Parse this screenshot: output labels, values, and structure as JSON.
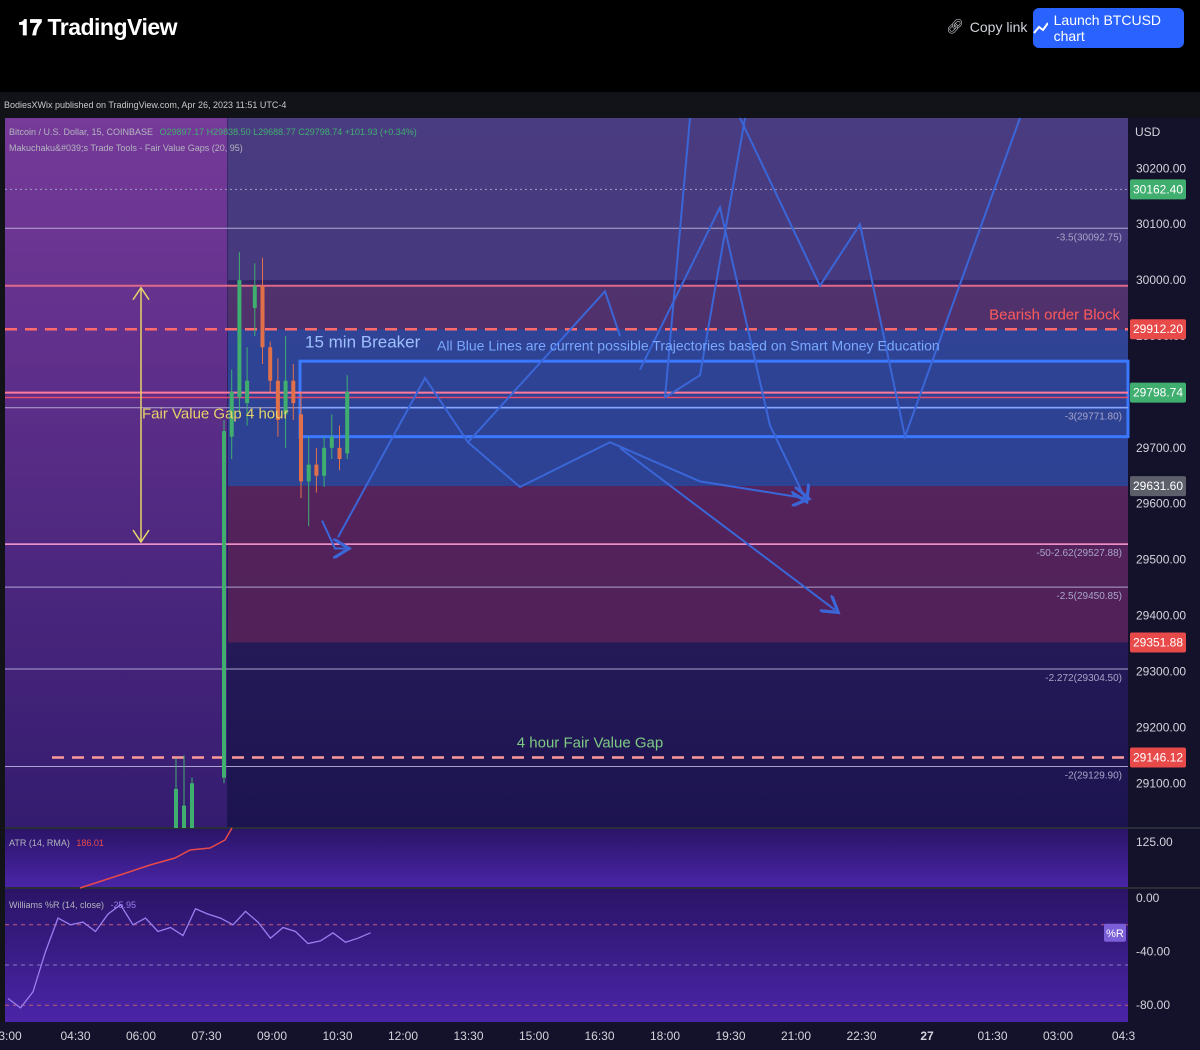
{
  "header": {
    "logo_text": "TradingView",
    "copy_link": "Copy link",
    "launch_button": "Launch BTCUSD chart"
  },
  "attribution": "BodiesXWix published on TradingView.com, Apr 26, 2023 11:51 UTC-4",
  "legend": {
    "symbol": "Bitcoin / U.S. Dollar, 15, COINBASE",
    "ohlc": "O29897.17  H29838.50  L29688.77  C29798.74  +101.93 (+0.34%)",
    "indicator": "Makuchaku&#039;s Trade Tools - Fair Value Gaps (20, 95)"
  },
  "atr": {
    "label": "ATR (14, RMA)",
    "value": "186.01",
    "axis_label": "125.00"
  },
  "williams": {
    "label": "Williams %R (14, close)",
    "value": "-25.95",
    "badge": "%R",
    "ticks": [
      "0.00",
      "-40.00",
      "-80.00"
    ]
  },
  "colors": {
    "blue_line": "#3a66d8",
    "bear_block": "#e84a4a",
    "fvg_yellow": "#e6d36a",
    "fvg_green": "#7fca84",
    "candle_up": "#3fae6f",
    "candle_down": "#e0704a"
  },
  "chart_data": {
    "type": "line",
    "symbol": "BTCUSD",
    "timeframe": "15",
    "currency": "USD",
    "ylim": [
      29020,
      30290
    ],
    "y_ticks": [
      30200,
      30100,
      30000,
      29900,
      29800,
      29700,
      29600,
      29500,
      29400,
      29300,
      29200,
      29100
    ],
    "x_ticks": [
      "3:00",
      "04:30",
      "06:00",
      "07:30",
      "09:00",
      "10:30",
      "12:00",
      "13:30",
      "15:00",
      "16:30",
      "18:00",
      "19:30",
      "21:00",
      "22:30",
      "27",
      "01:30",
      "03:00",
      "04:3"
    ],
    "price_labels": [
      {
        "value": 30162.4,
        "text": "30162.40",
        "color": "#3fae6f"
      },
      {
        "value": 29912.2,
        "text": "29912.20",
        "color": "#e84a4a"
      },
      {
        "value": 29798.74,
        "text": "29798.74",
        "color": "#3fae6f"
      },
      {
        "value": 29631.6,
        "text": "29631.60",
        "color": "#5d606b"
      },
      {
        "value": 29351.88,
        "text": "29351.88",
        "color": "#e84a4a"
      },
      {
        "value": 29146.12,
        "text": "29146.12",
        "color": "#e84a4a"
      }
    ],
    "fib_levels": [
      {
        "value": 30092.75,
        "text": "-3.5(30092.75)"
      },
      {
        "value": 29771.8,
        "text": "-3(29771.80)"
      },
      {
        "value": 29527.88,
        "text": "-50-2.62(29527.88)"
      },
      {
        "value": 29450.85,
        "text": "-2.5(29450.85)"
      },
      {
        "value": 29304.5,
        "text": "-2.272(29304.50)"
      },
      {
        "value": 29129.9,
        "text": "-2(29129.90)"
      }
    ],
    "annotations": {
      "bearish_block": "Bearish order Block",
      "breaker": "15 min Breaker",
      "trajectories": "All Blue Lines are current possible Trajectories based on Smart Money Education",
      "fvg_4h_left": "Fair Value Gap 4 hour",
      "fvg_4h_bottom": "4 hour Fair Value Gap"
    },
    "candles": [
      {
        "o": 29020,
        "h": 29145,
        "l": 29020,
        "c": 29090
      },
      {
        "o": 29020,
        "h": 29150,
        "l": 29020,
        "c": 29060
      },
      {
        "o": 29020,
        "h": 29110,
        "l": 29020,
        "c": 29100
      },
      {
        "o": 29110,
        "h": 29750,
        "l": 29100,
        "c": 29730
      },
      {
        "o": 29720,
        "h": 29840,
        "l": 29680,
        "c": 29800
      },
      {
        "o": 29790,
        "h": 30050,
        "l": 29760,
        "c": 30000
      },
      {
        "o": 29780,
        "h": 29880,
        "l": 29740,
        "c": 29820
      },
      {
        "o": 29950,
        "h": 30030,
        "l": 29900,
        "c": 29990
      },
      {
        "o": 29990,
        "h": 30040,
        "l": 29850,
        "c": 29880
      },
      {
        "o": 29880,
        "h": 29890,
        "l": 29800,
        "c": 29820
      },
      {
        "o": 29820,
        "h": 29860,
        "l": 29720,
        "c": 29750
      },
      {
        "o": 29760,
        "h": 29900,
        "l": 29700,
        "c": 29820
      },
      {
        "o": 29820,
        "h": 29850,
        "l": 29750,
        "c": 29780
      },
      {
        "o": 29760,
        "h": 29800,
        "l": 29610,
        "c": 29640
      },
      {
        "o": 29640,
        "h": 29720,
        "l": 29560,
        "c": 29670
      },
      {
        "o": 29670,
        "h": 29700,
        "l": 29620,
        "c": 29650
      },
      {
        "o": 29650,
        "h": 29720,
        "l": 29630,
        "c": 29700
      },
      {
        "o": 29700,
        "h": 29760,
        "l": 29680,
        "c": 29720
      },
      {
        "o": 29700,
        "h": 29740,
        "l": 29660,
        "c": 29680
      },
      {
        "o": 29690,
        "h": 29830,
        "l": 29680,
        "c": 29800
      }
    ],
    "trajectories": [
      [
        [
          29510,
          0
        ],
        [
          29680,
          1
        ],
        [
          29820,
          2
        ],
        [
          29730,
          3
        ],
        [
          29980,
          4
        ],
        [
          29620,
          5
        ]
      ],
      [
        [
          29700,
          0
        ],
        [
          29640,
          1
        ],
        [
          29980,
          2
        ],
        [
          30280,
          3
        ]
      ],
      [
        [
          29700,
          0
        ],
        [
          29630,
          1
        ],
        [
          29700,
          2
        ],
        [
          29640,
          3
        ]
      ],
      [
        [
          29720,
          0
        ],
        [
          29400,
          1
        ]
      ]
    ]
  }
}
